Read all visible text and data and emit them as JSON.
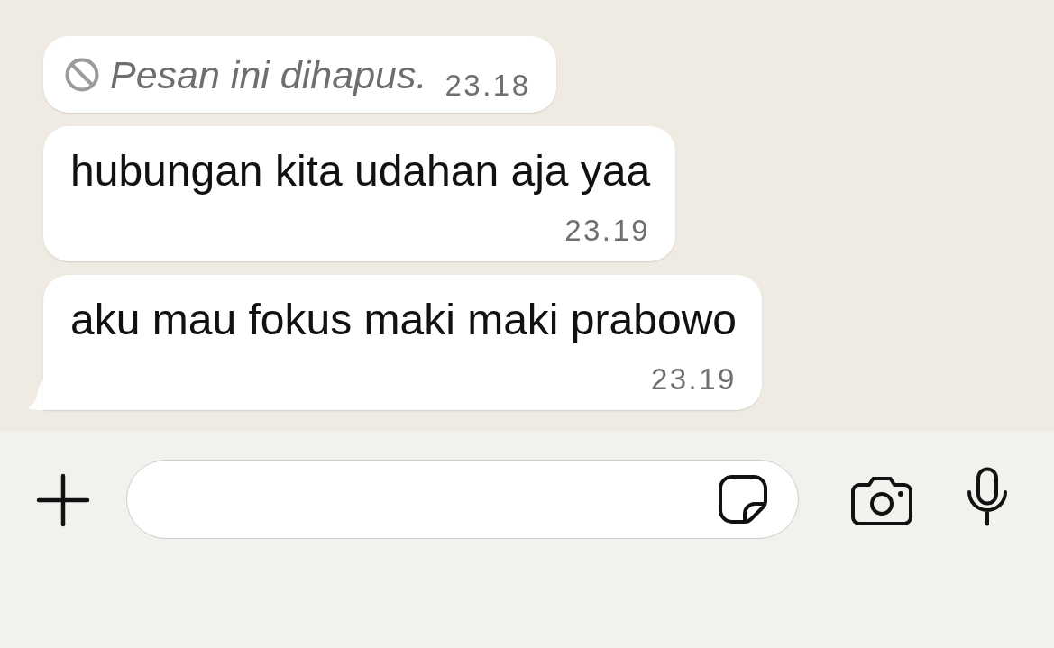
{
  "messages": [
    {
      "kind": "deleted",
      "text": "Pesan ini dihapus.",
      "time": "23.18",
      "tail": false
    },
    {
      "kind": "text",
      "text": "hubungan kita udahan aja yaa",
      "time": "23.19",
      "tail": false
    },
    {
      "kind": "text",
      "text": "aku mau fokus maki maki prabowo",
      "time": "23.19",
      "tail": true
    }
  ]
}
